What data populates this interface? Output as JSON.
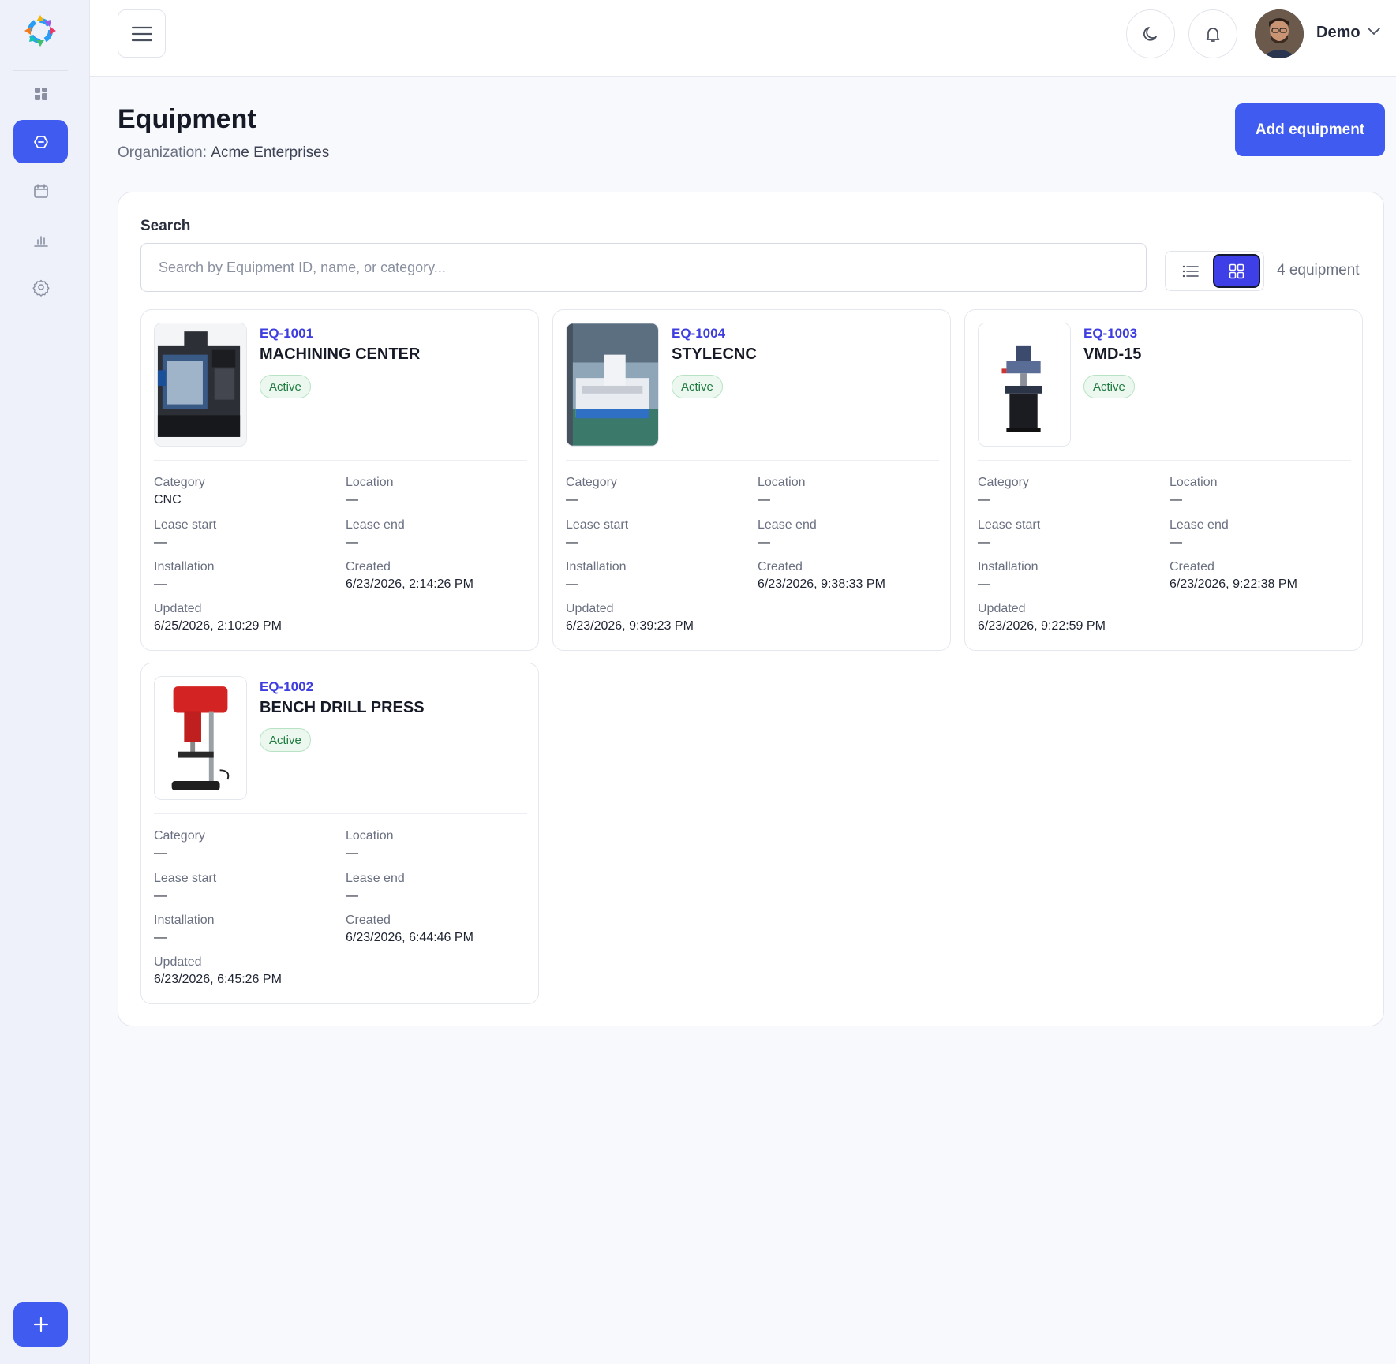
{
  "app": {
    "user_name": "Demo",
    "accent_color": "#3f5bf0"
  },
  "sidebar": {
    "items": [
      {
        "icon": "dashboard-grid-icon"
      },
      {
        "icon": "equipment-icon",
        "active": true
      },
      {
        "icon": "calendar-icon"
      },
      {
        "icon": "bar-chart-icon"
      },
      {
        "icon": "settings-icon"
      }
    ],
    "add_icon": "plus-icon"
  },
  "topbar": {
    "menu_icon": "hamburger-menu-icon",
    "theme_icon": "moon-icon",
    "notification_icon": "bell-icon"
  },
  "header": {
    "title": "Equipment",
    "org_label": "Organization:",
    "org_name": "Acme Enterprises",
    "add_button": "Add equipment"
  },
  "search": {
    "label": "Search",
    "placeholder": "Search by Equipment ID, name, or category...",
    "value": "",
    "count": "4 equipment",
    "view_mode": "grid"
  },
  "labels": {
    "category": "Category",
    "location": "Location",
    "lease_start": "Lease start",
    "lease_end": "Lease end",
    "installation": "Installation",
    "created": "Created",
    "updated": "Updated"
  },
  "equipment": [
    {
      "id": "EQ-1001",
      "name": "MACHINING CENTER",
      "status": "Active",
      "category": "CNC",
      "location": "—",
      "lease_start": "—",
      "lease_end": "—",
      "installation": "—",
      "created": "6/23/2026, 2:14:26 PM",
      "updated": "6/25/2026, 2:10:29 PM"
    },
    {
      "id": "EQ-1004",
      "name": "STYLECNC",
      "status": "Active",
      "category": "—",
      "location": "—",
      "lease_start": "—",
      "lease_end": "—",
      "installation": "—",
      "created": "6/23/2026, 9:38:33 PM",
      "updated": "6/23/2026, 9:39:23 PM"
    },
    {
      "id": "EQ-1003",
      "name": "VMD-15",
      "status": "Active",
      "category": "—",
      "location": "—",
      "lease_start": "—",
      "lease_end": "—",
      "installation": "—",
      "created": "6/23/2026, 9:22:38 PM",
      "updated": "6/23/2026, 9:22:59 PM"
    },
    {
      "id": "EQ-1002",
      "name": "BENCH DRILL PRESS",
      "status": "Active",
      "category": "—",
      "location": "—",
      "lease_start": "—",
      "lease_end": "—",
      "installation": "—",
      "created": "6/23/2026, 6:44:46 PM",
      "updated": "6/23/2026, 6:45:26 PM"
    }
  ]
}
